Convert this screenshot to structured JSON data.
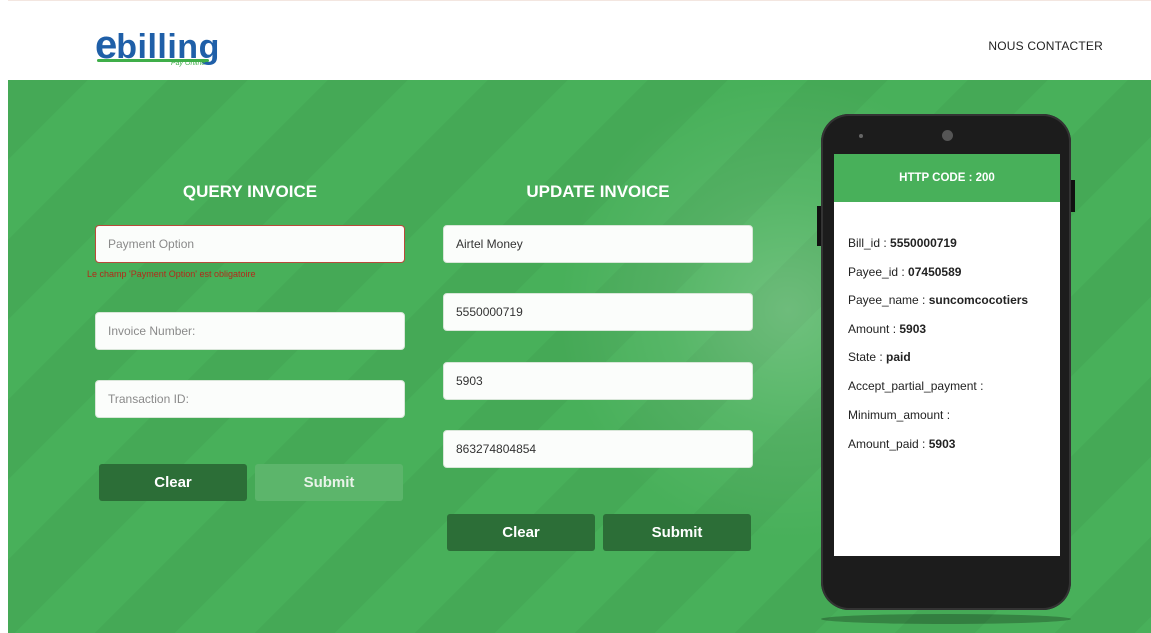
{
  "header": {
    "logo_e": "e",
    "logo_rest": "billing",
    "logo_tagline": "Pay Online",
    "contact_link": "NOUS CONTACTER"
  },
  "query": {
    "title": "QUERY INVOICE",
    "payment_option_placeholder": "Payment Option",
    "payment_option_error": "Le champ 'Payment Option' est obligatoire",
    "invoice_number_placeholder": "Invoice Number:",
    "transaction_id_placeholder": "Transaction ID:",
    "clear_label": "Clear",
    "submit_label": "Submit"
  },
  "update": {
    "title": "UPDATE INVOICE",
    "payment_option_value": "Airtel Money",
    "invoice_number_value": "5550000719",
    "amount_value": "5903",
    "transaction_value": "863274804854",
    "clear_label": "Clear",
    "submit_label": "Submit"
  },
  "phone": {
    "http_code": "HTTP CODE : 200",
    "fields": [
      {
        "label": "Bill_id : ",
        "value": "5550000719"
      },
      {
        "label": "Payee_id : ",
        "value": "07450589"
      },
      {
        "label": "Payee_name : ",
        "value": "suncomcocotiers"
      },
      {
        "label": "Amount : ",
        "value": "5903"
      },
      {
        "label": "State : ",
        "value": "paid"
      },
      {
        "label": "Accept_partial_payment :",
        "value": ""
      },
      {
        "label": "Minimum_amount :",
        "value": ""
      },
      {
        "label": "Amount_paid : ",
        "value": "5903"
      }
    ]
  },
  "colors": {
    "brand_green": "#48b05a",
    "button_dark": "#2c6e37",
    "logo_blue": "#1f5fa8",
    "error_red": "#b32a1a"
  }
}
